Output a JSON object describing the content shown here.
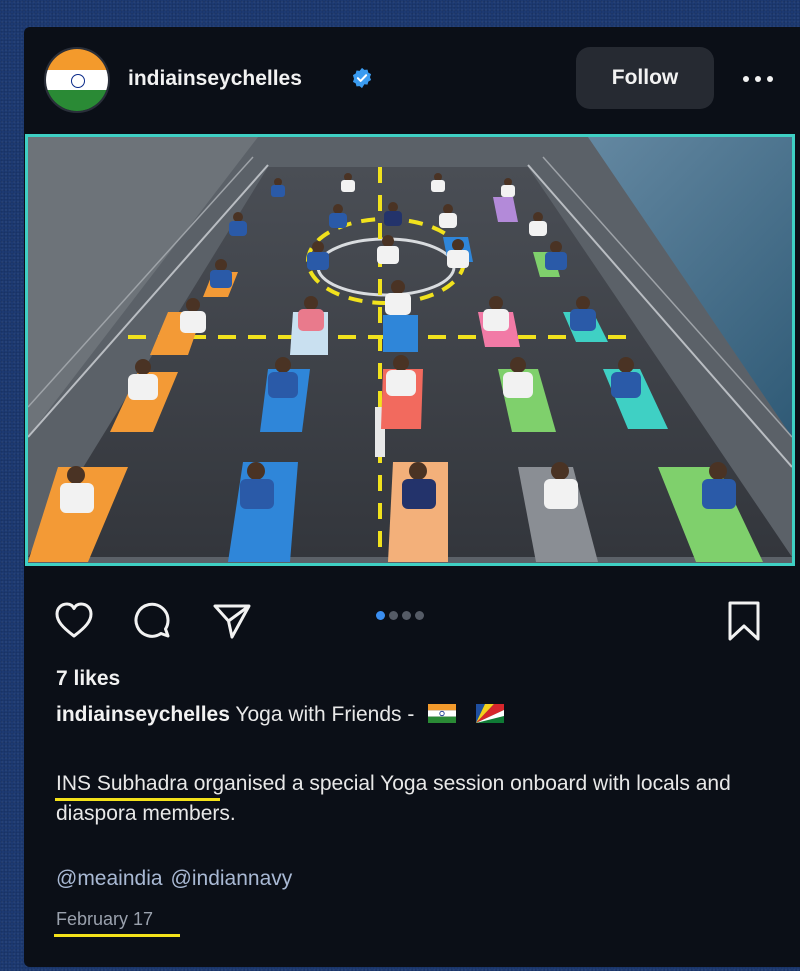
{
  "post": {
    "username": "indiainseychelles",
    "follow_label": "Follow",
    "likes": "7 likes",
    "caption_user": "indiainseychelles",
    "caption_text": "Yoga with Friends -",
    "body_highlight": "INS Subhadra",
    "body_rest": " organised a special Yoga session onboard with locals and diaspora members.",
    "mention_1": "@meaindia",
    "mention_2": "@indiannavy",
    "date": "February 17",
    "carousel_count": 4,
    "carousel_active": 1
  },
  "colors": {
    "accent_blue": "#3a8ef0",
    "photo_border": "#3fd0c4",
    "highlight_underline": "#f4e21a",
    "card_bg": "#0b0f17"
  },
  "icons": {
    "verified": "verified-badge-icon",
    "more": "more-horizontal-icon",
    "like": "heart-icon",
    "comment": "comment-icon",
    "share": "send-icon",
    "save": "bookmark-icon"
  }
}
